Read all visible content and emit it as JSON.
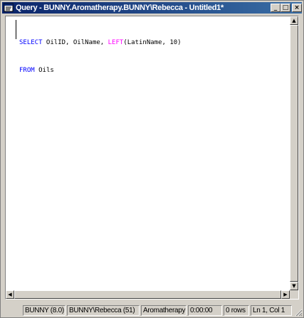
{
  "window": {
    "title": "Query - BUNNY.Aromatherapy.BUNNY\\Rebecca - Untitled1*",
    "minimize_glyph": "_",
    "maximize_glyph": "□",
    "close_glyph": "×"
  },
  "editor": {
    "lines": [
      {
        "kw1": "SELECT",
        "t1": " OilID, OilName, ",
        "fn": "LEFT",
        "t2": "(LatinName, 10)"
      },
      {
        "kw1": "FROM",
        "t1": " Oils",
        "fn": "",
        "t2": ""
      }
    ]
  },
  "scrollbars": {
    "up_glyph": "▲",
    "down_glyph": "▼",
    "left_glyph": "◀",
    "right_glyph": "▶"
  },
  "statusbar": {
    "server": "BUNNY (8.0)",
    "user": "BUNNY\\Rebecca (51)",
    "database": "Aromatherapy",
    "time": "0:00:00",
    "rows": "0 rows",
    "position": "Ln 1, Col 1"
  },
  "colors": {
    "titlebar_start": "#0a246a",
    "titlebar_end": "#3a6ea5",
    "keyword": "#0000ff",
    "function": "#ff00ff"
  }
}
